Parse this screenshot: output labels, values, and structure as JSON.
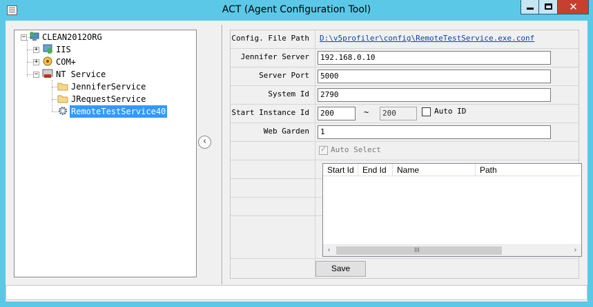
{
  "window": {
    "title": "ACT (Agent Configuration Tool)",
    "minimize_label": "",
    "maximize_label": "",
    "close_label": "✕"
  },
  "tree": {
    "root": {
      "label": "CLEAN2012ORG",
      "expanded": true
    },
    "children": [
      {
        "label": "IIS",
        "expanded": false
      },
      {
        "label": "COM+",
        "expanded": false
      },
      {
        "label": "NT Service",
        "expanded": true,
        "children": [
          {
            "label": "JenniferService",
            "icon": "folder-icon"
          },
          {
            "label": "JRequestService",
            "icon": "folder-icon"
          },
          {
            "label": "RemoteTestService40",
            "icon": "gear-icon",
            "selected": true
          }
        ]
      }
    ]
  },
  "splitter": {
    "glyph": "‹"
  },
  "form": {
    "config_file_path": {
      "label": "Config. File Path",
      "value": "D:\\v5profiler\\config\\RemoteTestService.exe.conf"
    },
    "jennifer_server": {
      "label": "Jennifer Server",
      "value": "192.168.0.10"
    },
    "server_port": {
      "label": "Server Port",
      "value": "5000"
    },
    "system_id": {
      "label": "System Id",
      "value": "2790"
    },
    "start_instance_id": {
      "label": "Start Instance Id",
      "start": "200",
      "separator": "~",
      "end": "200",
      "auto_id_label": "Auto ID",
      "auto_id_checked": false
    },
    "web_garden": {
      "label": "Web Garden",
      "value": "1"
    },
    "auto_select": {
      "label": "Auto Select",
      "checked": true,
      "enabled": false
    }
  },
  "listview": {
    "columns": [
      "Start Id",
      "End Id",
      "Name",
      "Path"
    ],
    "rows": [],
    "scroll_left": "‹",
    "scroll_right": "›",
    "thumb_grip": "III"
  },
  "buttons": {
    "save": "Save"
  },
  "colors": {
    "titlebar": "#5bc8e8",
    "selection": "#3399ff",
    "close_button": "#c7402f",
    "link": "#0645ad"
  }
}
